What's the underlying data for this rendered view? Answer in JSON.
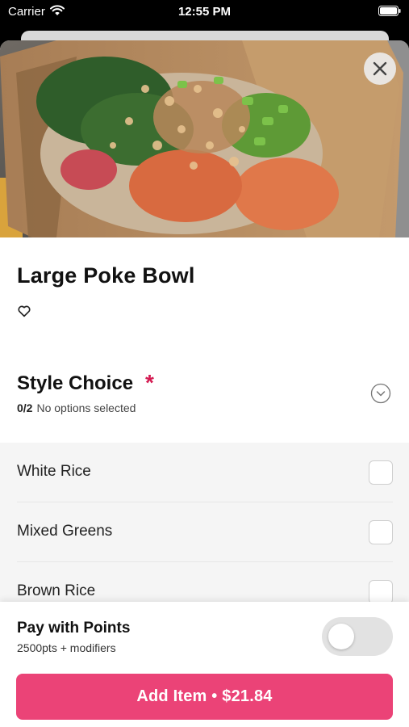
{
  "status_bar": {
    "carrier": "Carrier",
    "time": "12:55 PM"
  },
  "item": {
    "title": "Large Poke Bowl"
  },
  "modifier_group": {
    "title": "Style Choice",
    "required_mark": "*",
    "selected_count": "0/2",
    "status_text": "No options selected",
    "options": [
      {
        "label": "White Rice",
        "checked": false
      },
      {
        "label": "Mixed Greens",
        "checked": false
      },
      {
        "label": "Brown Rice",
        "checked": false
      }
    ]
  },
  "points": {
    "title": "Pay with Points",
    "subtitle": "2500pts + modifiers",
    "enabled": false
  },
  "add_button": {
    "label": "Add Item • $21.84"
  },
  "colors": {
    "accent": "#eb4377",
    "required": "#d41b52"
  },
  "icons": {
    "close": "close-icon",
    "favorite": "heart-outline-icon",
    "expand": "chevron-down-circle-icon"
  }
}
